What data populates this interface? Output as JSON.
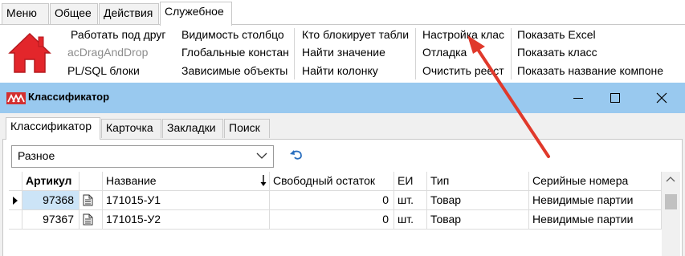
{
  "ribbon": {
    "tabs": [
      {
        "label": "Меню",
        "active": false
      },
      {
        "label": "Общее",
        "active": false
      },
      {
        "label": "Действия",
        "active": false
      },
      {
        "label": "Служебное",
        "active": true
      }
    ],
    "home_icon": "home-icon",
    "items": [
      {
        "label": "Работать под друг",
        "enabled": true
      },
      {
        "label": "acDragAndDrop",
        "enabled": false
      },
      {
        "label": "PL/SQL блоки",
        "enabled": true
      },
      {
        "label": "Видимость  столбцо",
        "enabled": true
      },
      {
        "label": "Глобальные констан",
        "enabled": true
      },
      {
        "label": "Зависимые объекты",
        "enabled": true
      },
      {
        "label": "Кто блокирует табли",
        "enabled": true
      },
      {
        "label": "Найти значение",
        "enabled": true
      },
      {
        "label": "Найти колонку",
        "enabled": true
      },
      {
        "label": "Настройка клас",
        "enabled": true
      },
      {
        "label": "Отладка",
        "enabled": true
      },
      {
        "label": "Очистить реест",
        "enabled": true
      },
      {
        "label": "Показать Excel",
        "enabled": true
      },
      {
        "label": "Показать класс",
        "enabled": true
      },
      {
        "label": "Показать название компоне",
        "enabled": true
      }
    ]
  },
  "window": {
    "title": "Классификатор",
    "logo_icon": "app-logo-icon",
    "controls": [
      "minimize-icon",
      "maximize-icon",
      "close-icon"
    ],
    "tabs": [
      {
        "label": "Классификатор",
        "active": true
      },
      {
        "label": "Карточка",
        "active": false
      },
      {
        "label": "Закладки",
        "active": false
      },
      {
        "label": "Поиск",
        "active": false
      }
    ],
    "combo": {
      "value": "Разное"
    },
    "undo_icon": "undo-icon"
  },
  "grid": {
    "headers": [
      "Артикул",
      "",
      "Название",
      "Свободный остаток",
      "ЕИ",
      "Тип",
      "Серийные номера"
    ],
    "sorted_column": "Название",
    "sort_direction": "descending",
    "rows": [
      [
        "97368",
        "",
        "171015-У1",
        "0",
        "шт.",
        "Товар",
        "Невидимые партии"
      ],
      [
        "97367",
        "",
        "171015-У2",
        "0",
        "шт.",
        "Товар",
        "Невидимые партии"
      ]
    ],
    "current_row": 0
  },
  "annotation": {
    "arrow_color": "#e0392b",
    "points_to": "Настройка клас"
  },
  "colors": {
    "titlebar": "#99c9ef",
    "selection": "#cce4f7",
    "home_icon": "#e3262b"
  }
}
